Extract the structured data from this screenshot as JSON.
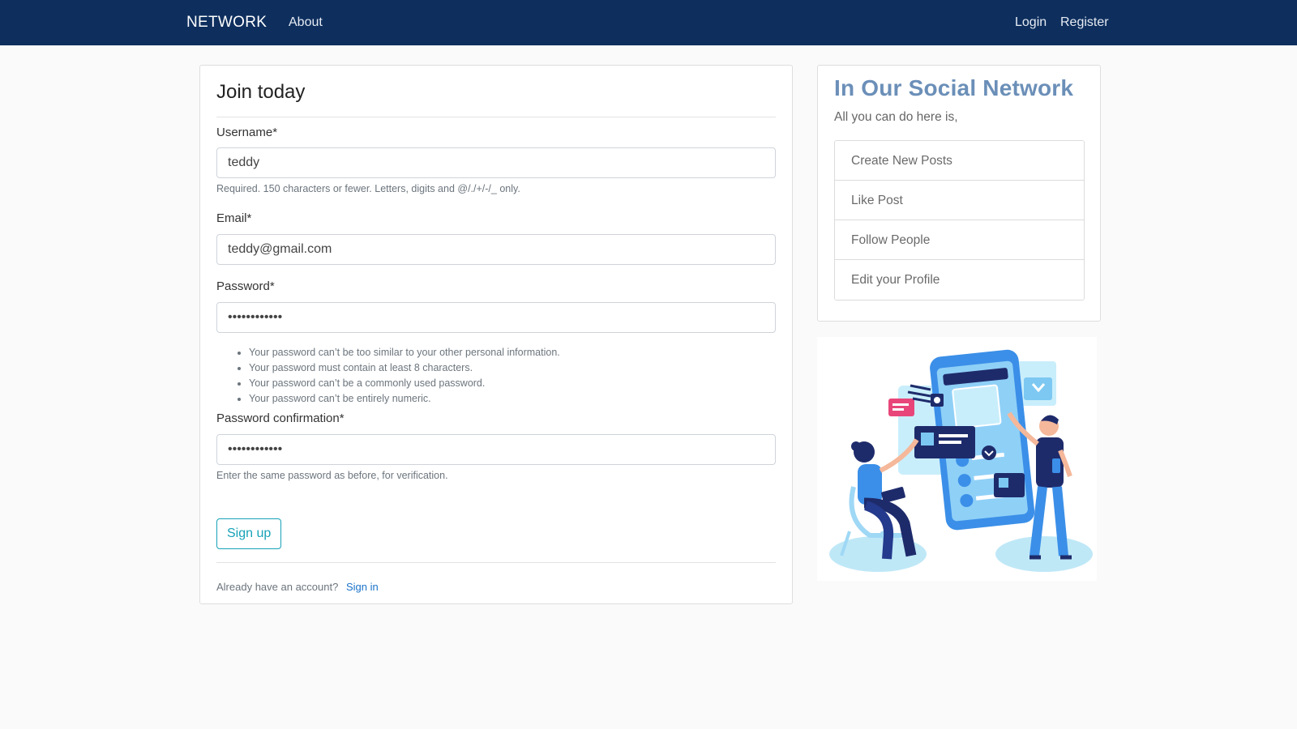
{
  "navbar": {
    "brand": "NETWORK",
    "about": "About",
    "login": "Login",
    "register": "Register"
  },
  "form": {
    "title": "Join today",
    "username_label": "Username*",
    "username_value": "teddy",
    "username_help": "Required. 150 characters or fewer. Letters, digits and @/./+/-/_ only.",
    "email_label": "Email*",
    "email_value": "teddy@gmail.com",
    "password_label": "Password*",
    "password_value": "teddyteddy12",
    "password_rules": [
      "Your password can’t be too similar to your other personal information.",
      "Your password must contain at least 8 characters.",
      "Your password can’t be a commonly used password.",
      "Your password can’t be entirely numeric."
    ],
    "password_confirm_label": "Password confirmation*",
    "password_confirm_value": "teddyteddy12",
    "password_confirm_help": "Enter the same password as before, for verification.",
    "submit_label": "Sign up",
    "footer_text": "Already have an account?",
    "footer_link": "Sign in"
  },
  "sidebar": {
    "title": "In Our Social Network",
    "subtitle": "All you can do here is,",
    "items": [
      {
        "label": "Create New Posts"
      },
      {
        "label": "Like Post"
      },
      {
        "label": "Follow People"
      },
      {
        "label": "Edit your Profile"
      }
    ]
  },
  "illustration": {
    "icon": "social-network-illustration",
    "colors": {
      "primary": "#3b8fe8",
      "light": "#9fd8f5",
      "dark": "#1e2b6b",
      "accent": "#e8467a"
    }
  },
  "theme": {
    "navbar_bg": "#0e2f5e",
    "accent": "#17a2b8",
    "link": "#1a73c9",
    "sidebar_title": "#6b8fb8"
  }
}
